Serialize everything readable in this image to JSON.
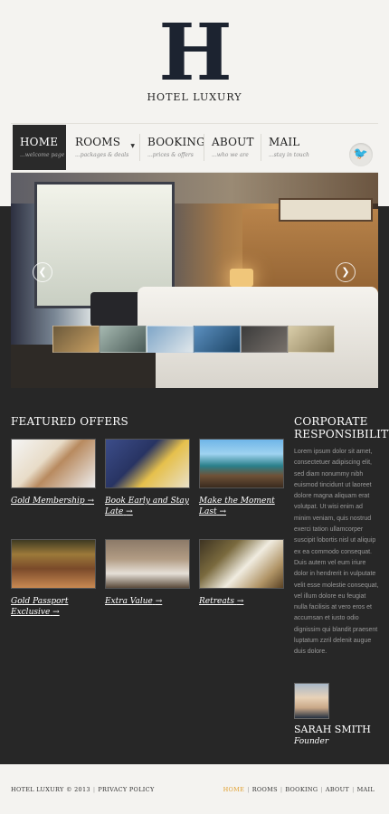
{
  "logo": {
    "letter": "H",
    "name": "HOTEL LUXURY"
  },
  "nav": {
    "items": [
      {
        "label": "HOME",
        "desc": "...welcome page"
      },
      {
        "label": "ROOMS",
        "desc": "...packages & deals"
      },
      {
        "label": "BOOKING",
        "desc": "...prices & offers"
      },
      {
        "label": "ABOUT",
        "desc": "...who we are"
      },
      {
        "label": "MAIL",
        "desc": "...stay in touch"
      }
    ],
    "active_index": 0,
    "twitter_icon": "twitter-icon"
  },
  "slider": {
    "prev_glyph": "❮",
    "next_glyph": "❯",
    "thumbnail_count": 6
  },
  "featured": {
    "title": "FEATURED OFFERS",
    "offers": [
      {
        "label": "Gold Membership",
        "arrow": "→"
      },
      {
        "label": "Book Early and Stay Late",
        "arrow": "→"
      },
      {
        "label": "Make the Moment Last",
        "arrow": "→"
      },
      {
        "label": "Gold Passport Exclusive",
        "arrow": "→"
      },
      {
        "label": "Extra Value",
        "arrow": "→"
      },
      {
        "label": "Retreats",
        "arrow": "→"
      }
    ]
  },
  "corporate": {
    "title": "CORPORATE RESPONSIBILITY",
    "text": "Lorem ipsum dolor sit amet, consectetuer adipiscing elit, sed diam nonummy nibh euismod tincidunt ut laoreet dolore magna aliquam erat volutpat. Ut wisi enim ad minim veniam, quis nostrud exerci tation ullamcorper suscipit lobortis nisl ut aliquip ex ea commodo consequat. Duis autem vel eum iriure dolor in hendrerit in vulputate velit esse molestie consequat, vel illum dolore eu feugiat nulla facilisis at vero eros et accumsan et iusto odio dignissim qui blandit praesent luptatum zzril delenit augue duis dolore.",
    "person_name": "SARAH SMITH",
    "person_role": "Founder"
  },
  "footer": {
    "copyright": "HOTEL LUXURY © 2013",
    "privacy": "PRIVACY POLICY",
    "links": [
      "HOME",
      "ROOMS",
      "BOOKING",
      "ABOUT",
      "MAIL"
    ],
    "active_link_color": "#e0a030"
  },
  "colors": {
    "dark_bg": "#272727",
    "light_bg": "#f4f3f0",
    "logo": "#1c2330"
  }
}
